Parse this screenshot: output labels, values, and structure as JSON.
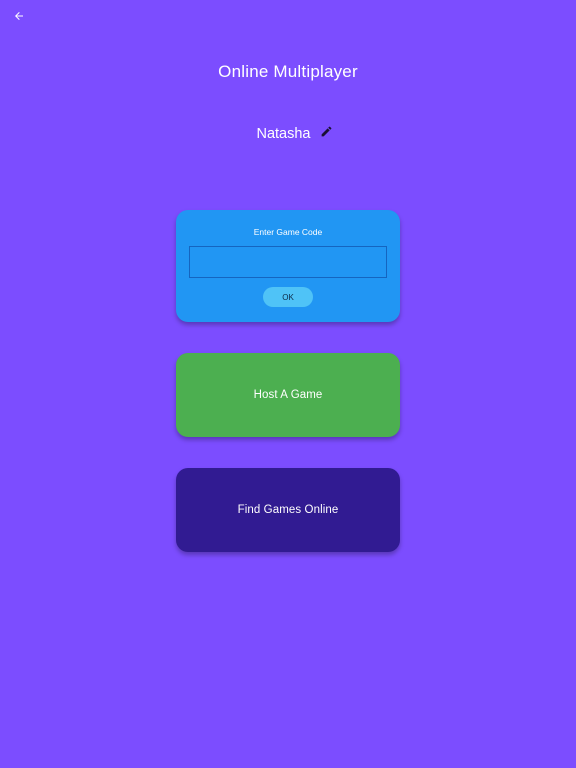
{
  "header": {
    "back_icon": "arrow-left-icon",
    "title": "Online Multiplayer"
  },
  "player": {
    "name": "Natasha",
    "edit_icon": "pencil-icon"
  },
  "join": {
    "label": "Enter Game Code",
    "input_value": "",
    "ok_label": "OK"
  },
  "host": {
    "label": "Host A Game"
  },
  "find": {
    "label": "Find Games Online"
  },
  "colors": {
    "background": "#7c4dff",
    "join_card": "#2196f3",
    "ok_button": "#4fc3f7",
    "host_card": "#4caf50",
    "find_card": "#311b92"
  }
}
